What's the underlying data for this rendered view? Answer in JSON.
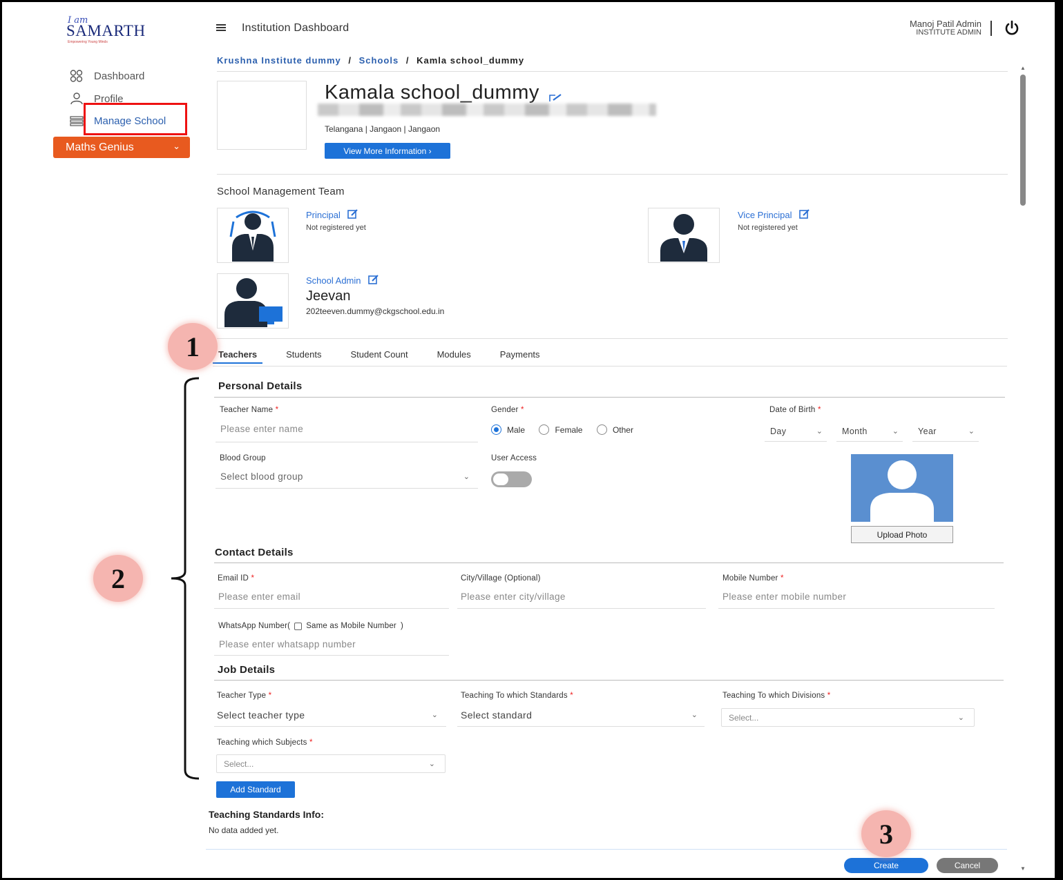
{
  "brand": {
    "tagline": "I am",
    "name": "SAMARTH",
    "subtitle": "Empowering Young Minds"
  },
  "sidebar": {
    "items": [
      {
        "label": "Dashboard",
        "icon": "dashboard-icon"
      },
      {
        "label": "Profile",
        "icon": "user-icon"
      },
      {
        "label": "Manage School",
        "icon": "school-icon"
      }
    ],
    "module_button": "Maths Genius"
  },
  "topbar": {
    "title": "Institution Dashboard",
    "user_name": "Manoj Patil Admin",
    "user_role": "INSTITUTE ADMIN"
  },
  "breadcrumb": {
    "institute": "Krushna Institute dummy",
    "schools": "Schools",
    "sep": "/",
    "current": "Kamla school_dummy"
  },
  "school": {
    "name": "Kamala school_dummy",
    "location": "Telangana | Jangaon | Jangaon",
    "view_more": "View More Information  ›"
  },
  "management": {
    "heading": "School Management Team",
    "principal": {
      "title": "Principal",
      "status": "Not registered yet"
    },
    "vice_principal": {
      "title": "Vice Principal",
      "status": "Not registered yet"
    },
    "school_admin": {
      "title": "School Admin",
      "name": "Jeevan",
      "email": "202teeven.dummy@ckgschool.edu.in"
    }
  },
  "tabs": [
    "Teachers",
    "Students",
    "Student Count",
    "Modules",
    "Payments"
  ],
  "personal": {
    "heading": "Personal Details",
    "teacher_name": {
      "label": "Teacher Name",
      "placeholder": "Please enter name"
    },
    "gender": {
      "label": "Gender",
      "options": [
        "Male",
        "Female",
        "Other"
      ],
      "selected": "Male"
    },
    "dob": {
      "label": "Date of Birth",
      "day": "Day",
      "month": "Month",
      "year": "Year"
    },
    "blood_group": {
      "label": "Blood Group",
      "placeholder": "Select blood group"
    },
    "user_access": {
      "label": "User Access",
      "on": false
    },
    "upload_photo": "Upload Photo"
  },
  "contact": {
    "heading": "Contact Details",
    "email": {
      "label": "Email ID",
      "placeholder": "Please enter email"
    },
    "city": {
      "label": "City/Village (Optional)",
      "placeholder": "Please enter city/village"
    },
    "mobile": {
      "label": "Mobile Number",
      "placeholder": "Please enter mobile number"
    },
    "whatsapp": {
      "label_pre": "WhatsApp Number(",
      "same_label": "Same as Mobile Number",
      "label_post": ")",
      "placeholder": "Please enter whatsapp number"
    }
  },
  "job": {
    "heading": "Job Details",
    "teacher_type": {
      "label": "Teacher Type",
      "placeholder": "Select teacher type"
    },
    "standards": {
      "label": "Teaching To which Standards",
      "placeholder": "Select standard"
    },
    "divisions": {
      "label": "Teaching To which Divisions",
      "placeholder": "Select..."
    },
    "subjects": {
      "label": "Teaching which Subjects",
      "placeholder": "Select..."
    },
    "add_standard": "Add Standard"
  },
  "standards_info": {
    "heading": "Teaching Standards Info:",
    "empty": "No data added yet."
  },
  "actions": {
    "create": "Create",
    "cancel": "Cancel"
  },
  "annotations": {
    "one": "1",
    "two": "2",
    "three": "3"
  },
  "colors": {
    "accent": "#1d72d8",
    "brand_orange": "#e85a1f",
    "highlight_red": "#e11111",
    "badge": "#f5b5b0"
  }
}
